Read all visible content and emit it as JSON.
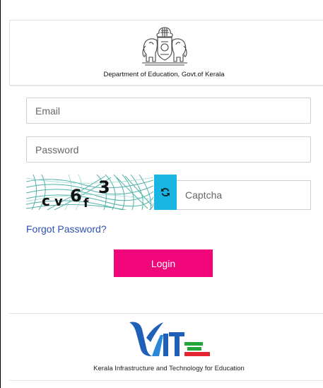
{
  "header": {
    "department": "Department of Education, Govt.of Kerala",
    "emblem_icon": "kerala-emblem-icon"
  },
  "form": {
    "email_placeholder": "Email",
    "password_placeholder": "Password",
    "captcha_text": "cv6f3",
    "captcha_placeholder": "Captcha",
    "refresh_icon": "refresh-icon",
    "forgot_label": "Forgot Password?",
    "login_label": "Login"
  },
  "footer": {
    "logo_icon": "kite-logo-icon",
    "tagline": "Kerala Infrastructure and Technology for Education"
  },
  "colors": {
    "login_button": "#f0067a",
    "refresh_button": "#19b6e3",
    "link": "#2f4fb5"
  }
}
